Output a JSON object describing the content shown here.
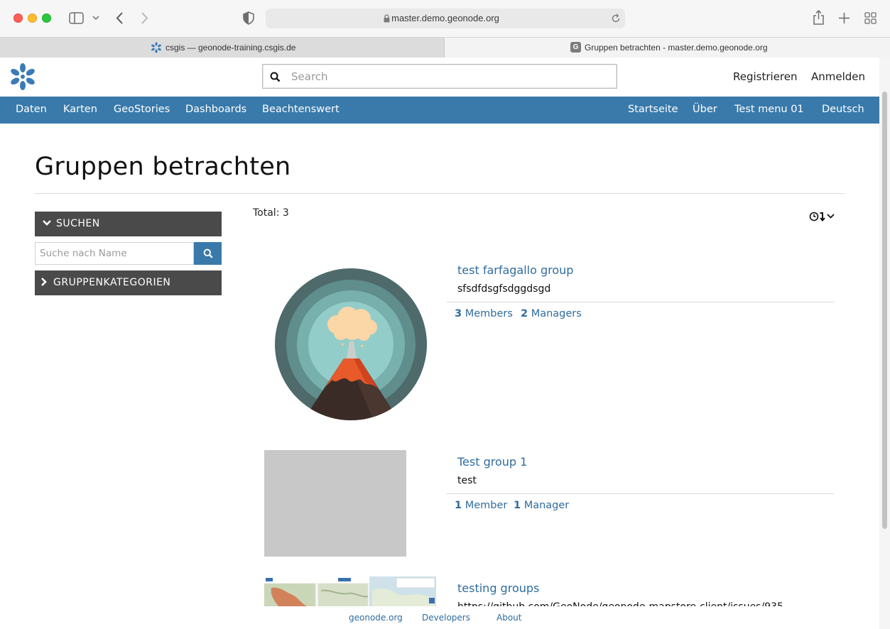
{
  "browser": {
    "url": "master.demo.geonode.org",
    "tabs": [
      {
        "title": "csgis — geonode-training.csgis.de",
        "active": false
      },
      {
        "title": "Gruppen betrachten - master.demo.geonode.org",
        "active": true,
        "favicon_letter": "G"
      }
    ]
  },
  "header": {
    "search_placeholder": "Search",
    "register": "Registrieren",
    "login": "Anmelden"
  },
  "nav": {
    "left": [
      "Daten",
      "Karten",
      "GeoStories",
      "Dashboards",
      "Beachtenswert"
    ],
    "right": [
      "Startseite",
      "Über",
      "Test menu 01",
      "Deutsch"
    ]
  },
  "page": {
    "title": "Gruppen betrachten",
    "total_label": "Total: 3"
  },
  "sidebar": {
    "search_panel": "SUCHEN",
    "name_placeholder": "Suche nach Name",
    "categories_panel": "GRUPPENKATEGORIEN"
  },
  "groups": [
    {
      "title": "test farfagallo group",
      "description": "sfsdfdsgfsdggdsgd",
      "members_count": "3",
      "members_label": "Members",
      "managers_count": "2",
      "managers_label": "Managers"
    },
    {
      "title": "Test group 1",
      "description": "test",
      "members_count": "1",
      "members_label": "Member",
      "managers_count": "1",
      "managers_label": "Manager"
    },
    {
      "title": "testing groups",
      "description": "https://github.com/GeoNode/geonode-mapstore-client/issues/935"
    }
  ],
  "footer": {
    "links": [
      "geonode.org",
      "Developers",
      "About"
    ]
  },
  "colors": {
    "navbar": "#397aab",
    "link": "#2f6c9f",
    "side_panel": "#4a4a4a"
  }
}
